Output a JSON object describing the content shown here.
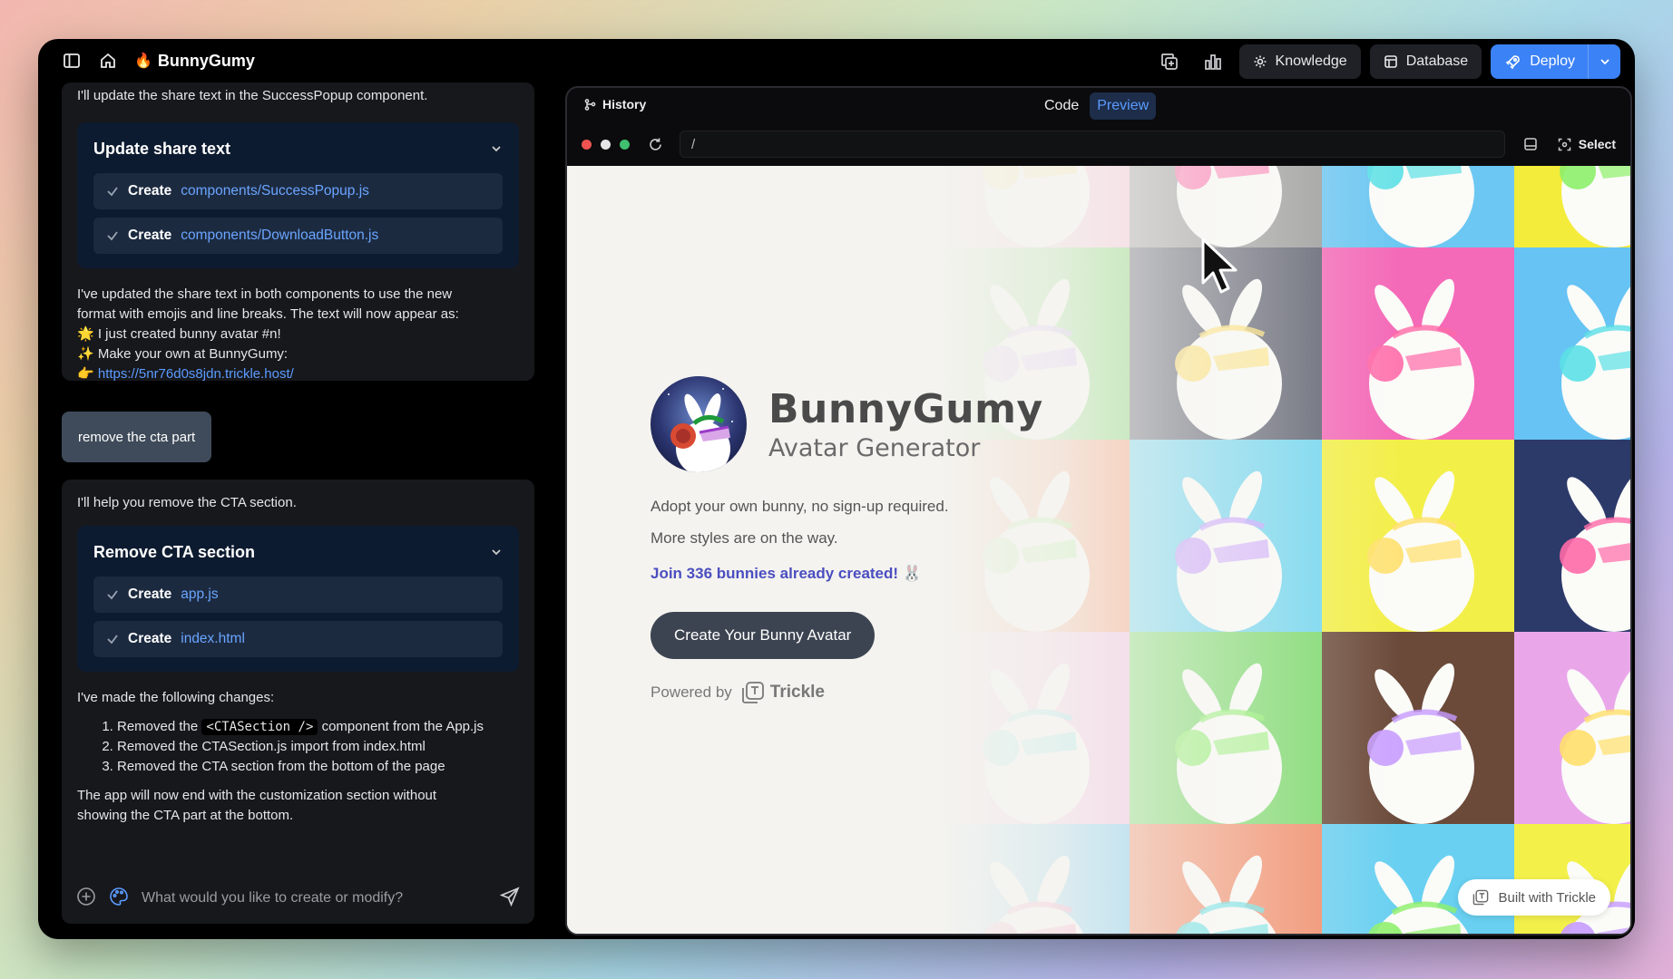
{
  "topbar": {
    "app_name": "BunnyGumy",
    "knowledge_label": "Knowledge",
    "database_label": "Database",
    "deploy_label": "Deploy"
  },
  "chat": {
    "msg1": {
      "intro": "I'll update the share text in the SuccessPopup component.",
      "card_title": "Update share text",
      "files": [
        {
          "action": "Create",
          "path": "components/SuccessPopup.js"
        },
        {
          "action": "Create",
          "path": "components/DownloadButton.js"
        }
      ],
      "body_line1": "I've updated the share text in both components to use the new",
      "body_line2": "format with emojis and line breaks. The text will now appear as:",
      "body_line3": "🌟 I just created bunny avatar #n!",
      "body_line4": "✨ Make your own at BunnyGumy:",
      "body_line5_prefix": "👉 ",
      "body_link": "https://5nr76d0s8jdn.trickle.host/"
    },
    "user_msg": "remove the cta part",
    "msg2": {
      "intro": "I'll help you remove the CTA section.",
      "card_title": "Remove CTA section",
      "files": [
        {
          "action": "Create",
          "path": "app.js"
        },
        {
          "action": "Create",
          "path": "index.html"
        }
      ],
      "changes_title": "I've made the following changes:",
      "change1_prefix": "Removed the ",
      "change1_code": "<CTASection />",
      "change1_suffix": " component from the App.js",
      "change2": "Removed the CTASection.js import from index.html",
      "change3": "Removed the CTA section from the bottom of the page",
      "outro_line1": "The app will now end with the customization section without",
      "outro_line2": "showing the CTA part at the bottom."
    },
    "input_placeholder": "What would you like to create or modify?"
  },
  "preview": {
    "history_label": "History",
    "tab_code": "Code",
    "tab_preview": "Preview",
    "url": "/",
    "select_label": "Select",
    "hero": {
      "title": "BunnyGumy",
      "subtitle": "Avatar Generator",
      "line1": "Adopt your own bunny, no sign-up required.",
      "line2": "More styles are on the way.",
      "join": "Join 336 bunnies already created! 🐰",
      "cta": "Create Your Bunny Avatar",
      "powered_by": "Powered by",
      "trickle": "Trickle"
    },
    "built_with": "Built with Trickle"
  },
  "tiles": [
    {
      "col": 0,
      "row": 0,
      "bg": "#f7c1d6"
    },
    {
      "col": 1,
      "row": 0,
      "bg": "#9a9a9a"
    },
    {
      "col": 2,
      "row": 0,
      "bg": "#6cc7f2"
    },
    {
      "col": 3,
      "row": 0,
      "bg": "#f4ec3a"
    },
    {
      "col": 0,
      "row": 1,
      "bg": "#7bd86a"
    },
    {
      "col": 1,
      "row": 1,
      "bg": "#5c5f6e"
    },
    {
      "col": 2,
      "row": 1,
      "bg": "#f46ab8"
    },
    {
      "col": 3,
      "row": 1,
      "bg": "#66c3f4"
    },
    {
      "col": 0,
      "row": 2,
      "bg": "#f79a6e"
    },
    {
      "col": 1,
      "row": 2,
      "bg": "#6fd6f0"
    },
    {
      "col": 2,
      "row": 2,
      "bg": "#f3ef49"
    },
    {
      "col": 3,
      "row": 2,
      "bg": "#2c3a6a"
    },
    {
      "col": 0,
      "row": 3,
      "bg": "#f5b8e0"
    },
    {
      "col": 1,
      "row": 3,
      "bg": "#7ad96a"
    },
    {
      "col": 2,
      "row": 3,
      "bg": "#6b4a3a"
    },
    {
      "col": 3,
      "row": 3,
      "bg": "#e9a7ea"
    },
    {
      "col": 0,
      "row": 4,
      "bg": "#67c5f1"
    },
    {
      "col": 1,
      "row": 4,
      "bg": "#f28a66"
    },
    {
      "col": 2,
      "row": 4,
      "bg": "#69d0f1"
    },
    {
      "col": 3,
      "row": 4,
      "bg": "#f3f04a"
    }
  ]
}
